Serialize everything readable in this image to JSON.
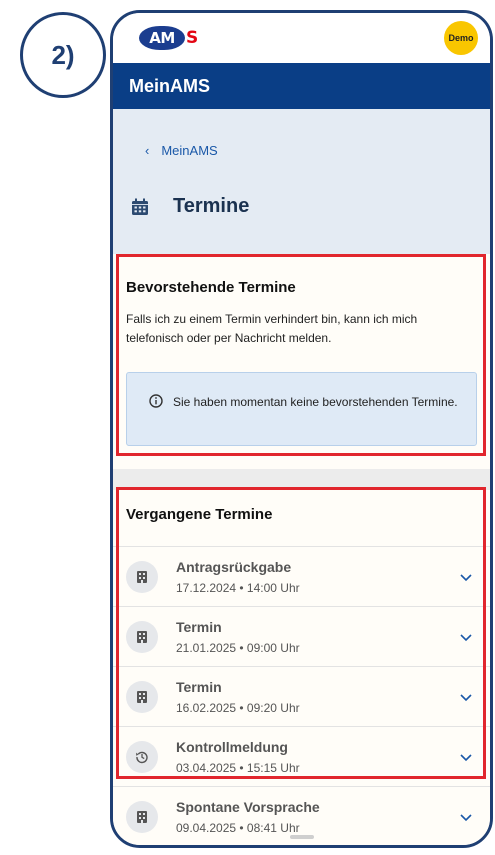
{
  "step_label": "2)",
  "brand": {
    "logo_left": "AM",
    "logo_right": "S",
    "demo_badge": "Demo"
  },
  "appbar": {
    "title": "MeinAMS"
  },
  "header": {
    "breadcrumb": "MeinAMS",
    "page_title": "Termine",
    "page_icon": "calendar-icon"
  },
  "upcoming": {
    "title": "Bevorstehende Termine",
    "description": "Falls ich zu einem Termin verhindert bin, kann ich mich telefonisch oder per Nachricht melden.",
    "info": "Sie haben momentan keine bevorstehenden Termine."
  },
  "past": {
    "title": "Vergangene Termine",
    "items": [
      {
        "title": "Antragsrückgabe",
        "date": "17.12.2024 • 14:00 Uhr",
        "icon": "building-icon"
      },
      {
        "title": "Termin",
        "date": "21.01.2025 • 09:00 Uhr",
        "icon": "building-icon"
      },
      {
        "title": "Termin",
        "date": "16.02.2025 • 09:20 Uhr",
        "icon": "building-icon"
      },
      {
        "title": "Kontrollmeldung",
        "date": "03.04.2025 • 15:15 Uhr",
        "icon": "history-icon"
      },
      {
        "title": "Spontane Vorsprache",
        "date": "09.04.2025 • 08:41 Uhr",
        "icon": "building-icon"
      }
    ]
  },
  "colors": {
    "highlight": "#e1262d",
    "appbar": "#0a3e86",
    "accent": "#1a58a8",
    "demo": "#f9c600"
  }
}
